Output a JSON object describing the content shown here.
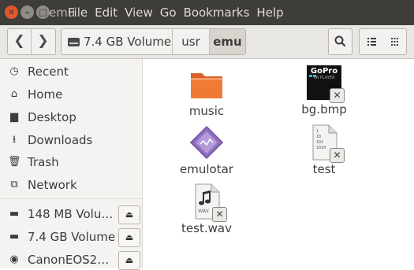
{
  "window": {
    "app_title": "emu",
    "menu": [
      "File",
      "Edit",
      "View",
      "Go",
      "Bookmarks",
      "Help"
    ]
  },
  "toolbar": {
    "back_glyph": "❮",
    "forward_glyph": "❯",
    "breadcrumb": [
      "7.4 GB Volume",
      "usr",
      "emu"
    ]
  },
  "sidebar": {
    "places": [
      {
        "label": "Recent",
        "icon": "clock-icon"
      },
      {
        "label": "Home",
        "icon": "home-icon"
      },
      {
        "label": "Desktop",
        "icon": "folder-icon"
      },
      {
        "label": "Downloads",
        "icon": "download-arrow-icon"
      },
      {
        "label": "Trash",
        "icon": "trash-icon"
      },
      {
        "label": "Network",
        "icon": "network-icon"
      }
    ],
    "devices": [
      {
        "label": "148 MB Volu…",
        "icon": "drive-icon"
      },
      {
        "label": "7.4 GB Volume",
        "icon": "drive-icon"
      },
      {
        "label": "CanonEOS2…",
        "icon": "camera-icon"
      }
    ]
  },
  "files": [
    {
      "name": "music",
      "type": "folder",
      "icon": "folder-icon"
    },
    {
      "name": "bg.bmp",
      "type": "image",
      "icon": "image-thumbnail-icon",
      "thumb_text": "GoPro",
      "thumb_sub": "VR PLAYER"
    },
    {
      "name": "emulotar",
      "type": "executable",
      "icon": "executable-diamond-icon"
    },
    {
      "name": "test",
      "type": "binary",
      "icon": "binary-file-icon",
      "thumb_lines": [
        "1",
        "10",
        "101",
        "1010"
      ]
    },
    {
      "name": "test.wav",
      "type": "audio",
      "icon": "audio-file-icon",
      "thumb_text": "WAV"
    }
  ],
  "colors": {
    "titlebar": "#3e3d39",
    "close_button": "#e2572c",
    "folder": "#f07a35",
    "sidebar_bg": "#f4f3f1",
    "exec_purple": "#8e6fc1"
  }
}
